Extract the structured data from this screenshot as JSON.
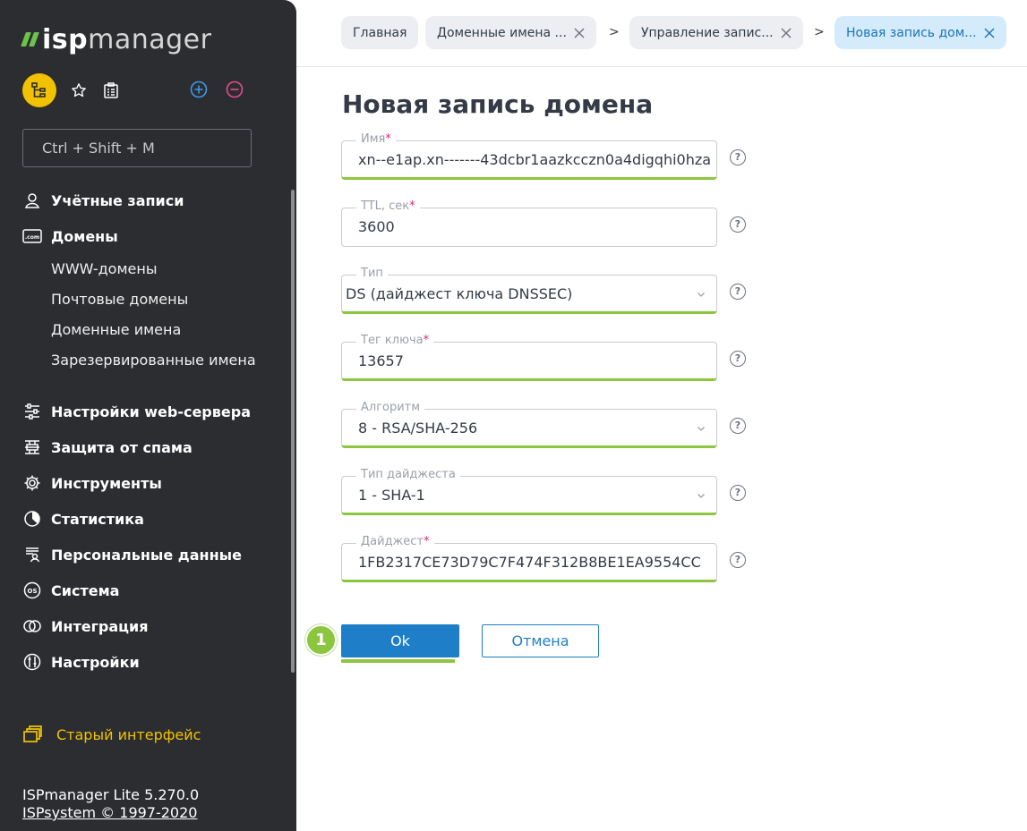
{
  "app": {
    "logo_isp": "isp",
    "logo_manager": "manager"
  },
  "sidebar": {
    "search_placeholder": "Ctrl + Shift + M",
    "nav": [
      {
        "label": "Учётные записи",
        "icon": "user-pin-icon"
      },
      {
        "label": "Домены",
        "icon": "com-domain-icon"
      },
      {
        "label": "Настройки web-сервера",
        "icon": "sliders-icon"
      },
      {
        "label": "Защита от спама",
        "icon": "firewall-icon"
      },
      {
        "label": "Инструменты",
        "icon": "gear-icon"
      },
      {
        "label": "Статистика",
        "icon": "pie-chart-icon"
      },
      {
        "label": "Персональные данные",
        "icon": "personal-data-icon"
      },
      {
        "label": "Система",
        "icon": "os-icon"
      },
      {
        "label": "Интеграция",
        "icon": "rings-icon"
      },
      {
        "label": "Настройки",
        "icon": "settings-tools-icon"
      }
    ],
    "domain_sub": [
      "WWW-домены",
      "Почтовые домены",
      "Доменные имена",
      "Зарезервированные имена"
    ],
    "old_interface": "Старый интерфейс",
    "version": "ISPmanager Lite 5.270.0",
    "copyright": "ISPsystem © 1997-2020"
  },
  "breadcrumbs": [
    {
      "label": "Главная",
      "closable": false
    },
    {
      "label": "Доменные имена ...",
      "closable": true
    },
    {
      "label": "Управление запис...",
      "closable": true
    },
    {
      "label": "Новая запись дом...",
      "closable": true,
      "active": true
    }
  ],
  "breadcrumb_separator": ">",
  "page": {
    "title": "Новая запись домена",
    "fields": [
      {
        "label": "Имя",
        "required": true,
        "value": "xn--e1ap.xn-------43dcbr1aazkcczn0a4digqhi0hza",
        "type": "text"
      },
      {
        "label": "TTL, сек",
        "required": true,
        "value": "3600",
        "type": "text"
      },
      {
        "label": "Тип",
        "required": false,
        "value": "DS (дайджест ключа DNSSEC)",
        "type": "select"
      },
      {
        "label": "Тег ключа",
        "required": true,
        "value": "13657",
        "type": "text"
      },
      {
        "label": "Алгоритм",
        "required": false,
        "value": "8 - RSA/SHA-256",
        "type": "select"
      },
      {
        "label": "Тип дайджеста",
        "required": false,
        "value": "1 - SHA-1",
        "type": "select"
      },
      {
        "label": "Дайджест",
        "required": true,
        "value": "1FB2317CE73D79C7F474F312B8BE1EA9554CC",
        "type": "text"
      }
    ],
    "help_glyph": "?",
    "required_mark": "*",
    "ok_label": "Ok",
    "cancel_label": "Отмена",
    "step_badge": "1"
  },
  "colors": {
    "sidebar_bg": "#2b2d31",
    "accent_yellow": "#f2c200",
    "brand_green": "#6cc24a",
    "field_underline_green": "#8cc63f",
    "primary_blue": "#1e7fc8",
    "active_crumb_bg": "#d4ebfb"
  }
}
